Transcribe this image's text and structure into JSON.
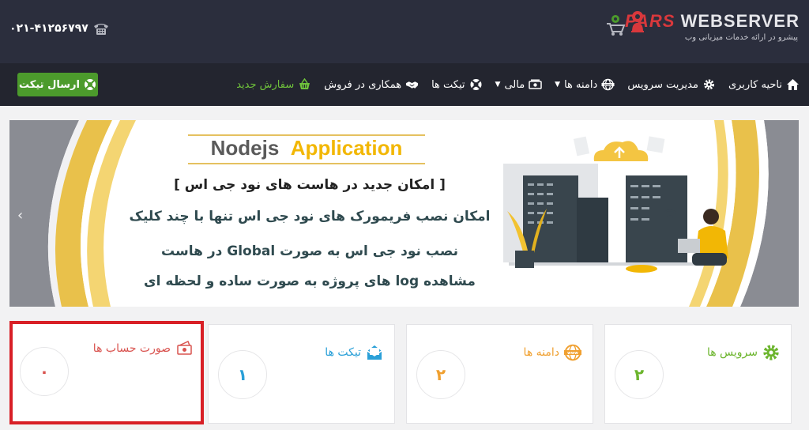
{
  "header": {
    "logo_brand": "PARS",
    "logo_rest": " WEBSERVER",
    "logo_tagline": "پیشرو در ارائه خدمات میزبانی وب",
    "phone": "۰۲۱-۴۱۲۵۶۷۹۷",
    "icons": [
      "phone-icon",
      "cart-icon",
      "bell-icon"
    ]
  },
  "nav": {
    "ticket_button": "ارسال تیکت",
    "items": [
      {
        "label": "ناحیه کاربری",
        "icon": "home-icon"
      },
      {
        "label": "مدیریت سرویس",
        "icon": "gear-icon"
      },
      {
        "label": "دامنه ها",
        "icon": "www-icon",
        "dropdown": true
      },
      {
        "label": "مالی",
        "icon": "money-icon",
        "dropdown": true
      },
      {
        "label": "تیکت ها",
        "icon": "support-icon"
      },
      {
        "label": "همکاری در فروش",
        "icon": "handshake-icon"
      },
      {
        "label": "سفارش جدید",
        "icon": "basket-icon",
        "color": "#6fc23b"
      }
    ]
  },
  "banner": {
    "title_part1": "Nodejs",
    "title_part2": "Application",
    "line1": "[ امکان جدید در هاست های نود جی اس ]",
    "line2": "امکان نصب فریمورک های نود جی اس تنها با چند کلیک",
    "line3": "نصب نود جی اس به صورت Global در هاست",
    "line4": "مشاهده log های پروژه به صورت ساده و لحظه ای",
    "accent_color": "#f2b705"
  },
  "cards": [
    {
      "label": "سرویس ها",
      "value": "۲",
      "icon": "gear-icon",
      "color": "#6cb52d"
    },
    {
      "label": "دامنه ها",
      "value": "۲",
      "icon": "www-icon",
      "color": "#f0a030"
    },
    {
      "label": "تیکت ها",
      "value": "۱",
      "icon": "envelope-icon",
      "color": "#2aa0d8"
    },
    {
      "label": "صورت حساب ها",
      "value": "۰",
      "icon": "invoice-icon",
      "color": "#d9534f",
      "highlighted": true
    }
  ]
}
